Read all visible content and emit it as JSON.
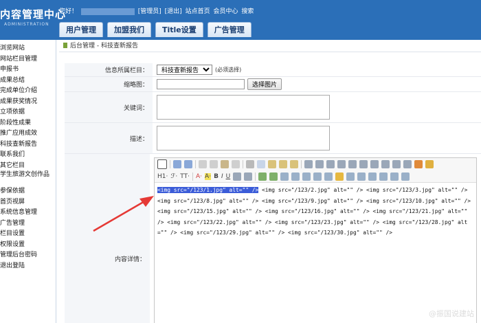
{
  "header": {
    "title": "内容管理中心",
    "subtitle": "ADMINISTRATION",
    "greeting": "您好！",
    "links": [
      "[管理员]",
      "[退出]",
      "站点首页",
      "会员中心",
      "搜索"
    ],
    "tabs": [
      "用户管理",
      "加盟我们",
      "Title设置",
      "广告管理"
    ]
  },
  "sidebar": {
    "items": [
      "浏览网站",
      "网站栏目管理",
      "申报书",
      "成果总结",
      "完成单位介绍",
      "成果获奖情况",
      "立项依据",
      "阶段性成果",
      "推广应用成效",
      "科技查新报告",
      "联系我们",
      "其它栏目",
      "学生旅游文创作品",
      "参保依据",
      "首页视屏",
      "系统信息管理",
      "广告管理",
      "栏目设置",
      "权限设置",
      "管理后台密码",
      "退出登陆"
    ]
  },
  "breadcrumb": "后台管理 - 科技查新报告",
  "form": {
    "category_label": "信息所属栏目：",
    "category_value": "科技查新报告",
    "category_hint": "(必须选择)",
    "thumb_label": "缩略图：",
    "pick_button": "选择图片",
    "keywords_label": "关键词：",
    "desc_label": "描述：",
    "content_label": "内容详情："
  },
  "editor": {
    "toolbar_texts": [
      "H1·",
      "ℱ·",
      "TT·",
      "A·",
      "A·",
      "B",
      "I",
      "U"
    ],
    "selected_code": "<img src=\"/123/1.jpg\" alt=\"\" />",
    "code": " <img src=\"/123/2.jpg\" alt=\"\" /> <img src=\"/123/3.jpg\" alt=\"\" /> <img src=\"/123/8.jpg\" alt=\"\" /> <img src=\"/123/9.jpg\" alt=\"\" /> <img src=\"/123/10.jpg\" alt=\"\" /> <img src=\"/123/15.jpg\" alt=\"\" /> <img src=\"/123/16.jpg\" alt=\"\" /> <img src=\"/123/21.jpg\" alt=\"\" /> <img src=\"/123/22.jpg\" alt=\"\" /> <img src=\"/123/23.jpg\" alt=\"\" /> <img src=\"/123/28.jpg\" alt=\"\" /> <img src=\"/123/29.jpg\" alt=\"\" /> <img src=\"/123/30.jpg\" alt=\"\" />"
  },
  "watermark": "@振国说建站",
  "colors": {
    "header": "#2b6fb8",
    "arrow": "#e53935",
    "selection": "#3b5cd8"
  }
}
